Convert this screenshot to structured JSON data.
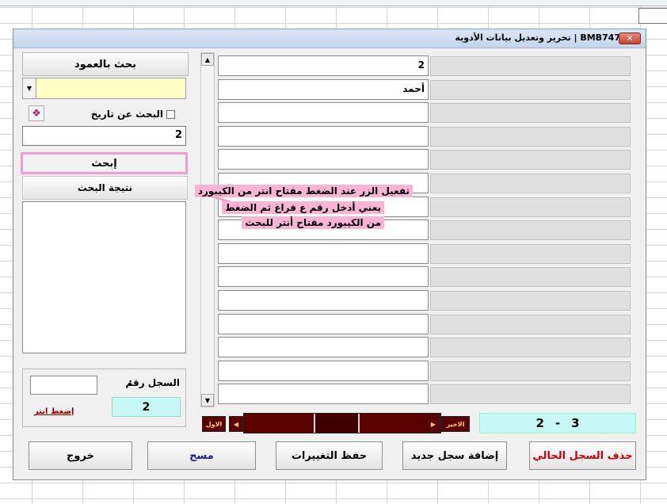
{
  "window": {
    "title": "BMB747 | تحرير وتعديل بيانات الأدوية",
    "close_label": "✕"
  },
  "left": {
    "search_by_column_label": "بحث بالعمود",
    "combo_value": "",
    "date_search_label": "البحث عن تاريخ",
    "search_value": "2",
    "search_button_label": "إبحث",
    "result_label": "نتيجة البحث",
    "record_label": "السجل رقم",
    "record_colon": ":",
    "record_input_value": "",
    "press_enter_label": "إضغط انتر",
    "record_number": "2"
  },
  "fields": [
    {
      "value": "2"
    },
    {
      "value": "أحمد"
    },
    {
      "value": ""
    },
    {
      "value": ""
    },
    {
      "value": ""
    },
    {
      "value": ""
    },
    {
      "value": ""
    },
    {
      "value": ""
    },
    {
      "value": ""
    },
    {
      "value": ""
    },
    {
      "value": ""
    },
    {
      "value": ""
    },
    {
      "value": ""
    },
    {
      "value": ""
    },
    {
      "value": ""
    }
  ],
  "navigation": {
    "first_label": "الاول",
    "last_label": "الاخير",
    "position": {
      "current": "2",
      "separator": "-",
      "total": "3"
    }
  },
  "buttons": {
    "exit": "خروج",
    "clear": "مسح",
    "save": "حفظ التغييرات",
    "add": "إضافة سجل جديد",
    "delete": "حذف السجل الحالي"
  },
  "annotation": {
    "line1": "تفعيل الزر عند الضغط مفتاح انتر من الكيبورد",
    "line2": "يعني أدخل رقم ع فراغ ثم الضغط",
    "line3": "من الكيبورد مفتاح أنتر للبحث"
  },
  "colors": {
    "accent_pink": "#f7b4d4",
    "nav_dark": "#5b0000",
    "info_cyan": "#c8f7f7",
    "delete_red": "#d00000"
  },
  "icons": [
    "close-icon",
    "chevron-down-icon",
    "book-icon",
    "arrow-up-icon",
    "arrow-down-icon",
    "arrow-left-icon",
    "arrow-right-icon"
  ]
}
